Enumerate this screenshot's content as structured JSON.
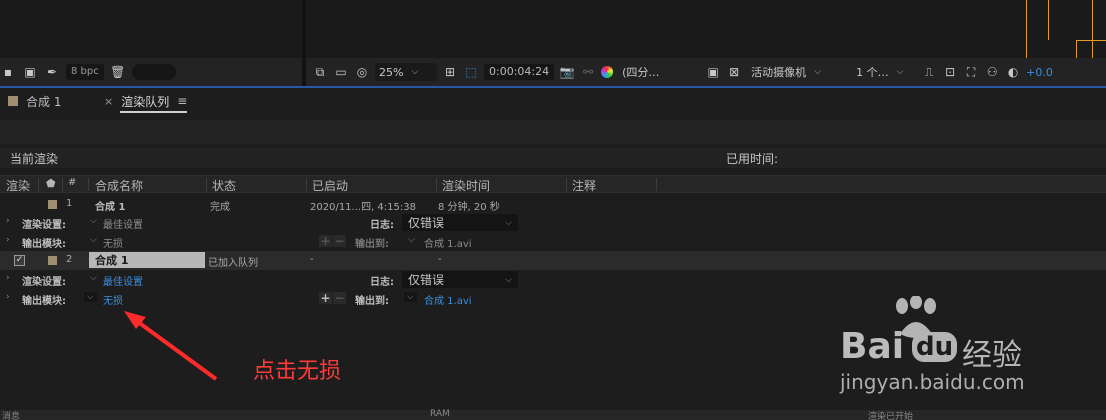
{
  "toolbar_left": {
    "bpc": "8 bpc"
  },
  "toolbar_right": {
    "zoom": "25%",
    "timecode": "0:00:04:24",
    "resolution": "(四分…",
    "camera": "活动摄像机",
    "views": "1 个…",
    "exposure": "+0.0"
  },
  "tabs": [
    {
      "label": "合成 1"
    },
    {
      "label": "渲染队列",
      "close": "×",
      "menu": "≡"
    }
  ],
  "current_render": {
    "label": "当前渲染",
    "elapsed_label": "已用时间:"
  },
  "columns": {
    "render": "渲染",
    "tag": "",
    "num": "#",
    "comp_name": "合成名称",
    "status": "状态",
    "started": "已启动",
    "render_time": "渲染时间",
    "comment": "注释"
  },
  "items": [
    {
      "num": "1",
      "name": "合成 1",
      "status": "完成",
      "started": "2020/11...四, 4:15:38",
      "render_time": "8 分钟, 20 秒",
      "settings_label": "渲染设置:",
      "settings_value": "最佳设置",
      "log_label": "日志:",
      "log_value": "仅错误",
      "output_module_label": "输出模块:",
      "output_module_value": "无损",
      "output_to_label": "输出到:",
      "output_file": "合成 1.avi"
    },
    {
      "num": "2",
      "name": "合成 1",
      "status": "已加入队列",
      "started": "-",
      "render_time": "-",
      "settings_label": "渲染设置:",
      "settings_value": "最佳设置",
      "log_label": "日志:",
      "log_value": "仅错误",
      "output_module_label": "输出模块:",
      "output_module_value": "无损",
      "output_to_label": "输出到:",
      "output_file": "合成 1.avi"
    }
  ],
  "annotation": "点击无损",
  "watermark": {
    "brand": "Bai",
    "brand2": "du",
    "cn": "经验",
    "url": "jingyan.baidu.com"
  },
  "bottom": {
    "a": "消息",
    "b": "RAM",
    "c": "渲染已开始"
  },
  "colors": {
    "accent_blue": "#3a8fe0",
    "annotation_red": "#ff3a3a",
    "label_swatch": "#a08e70",
    "viewer_guide": "#e39a22"
  }
}
